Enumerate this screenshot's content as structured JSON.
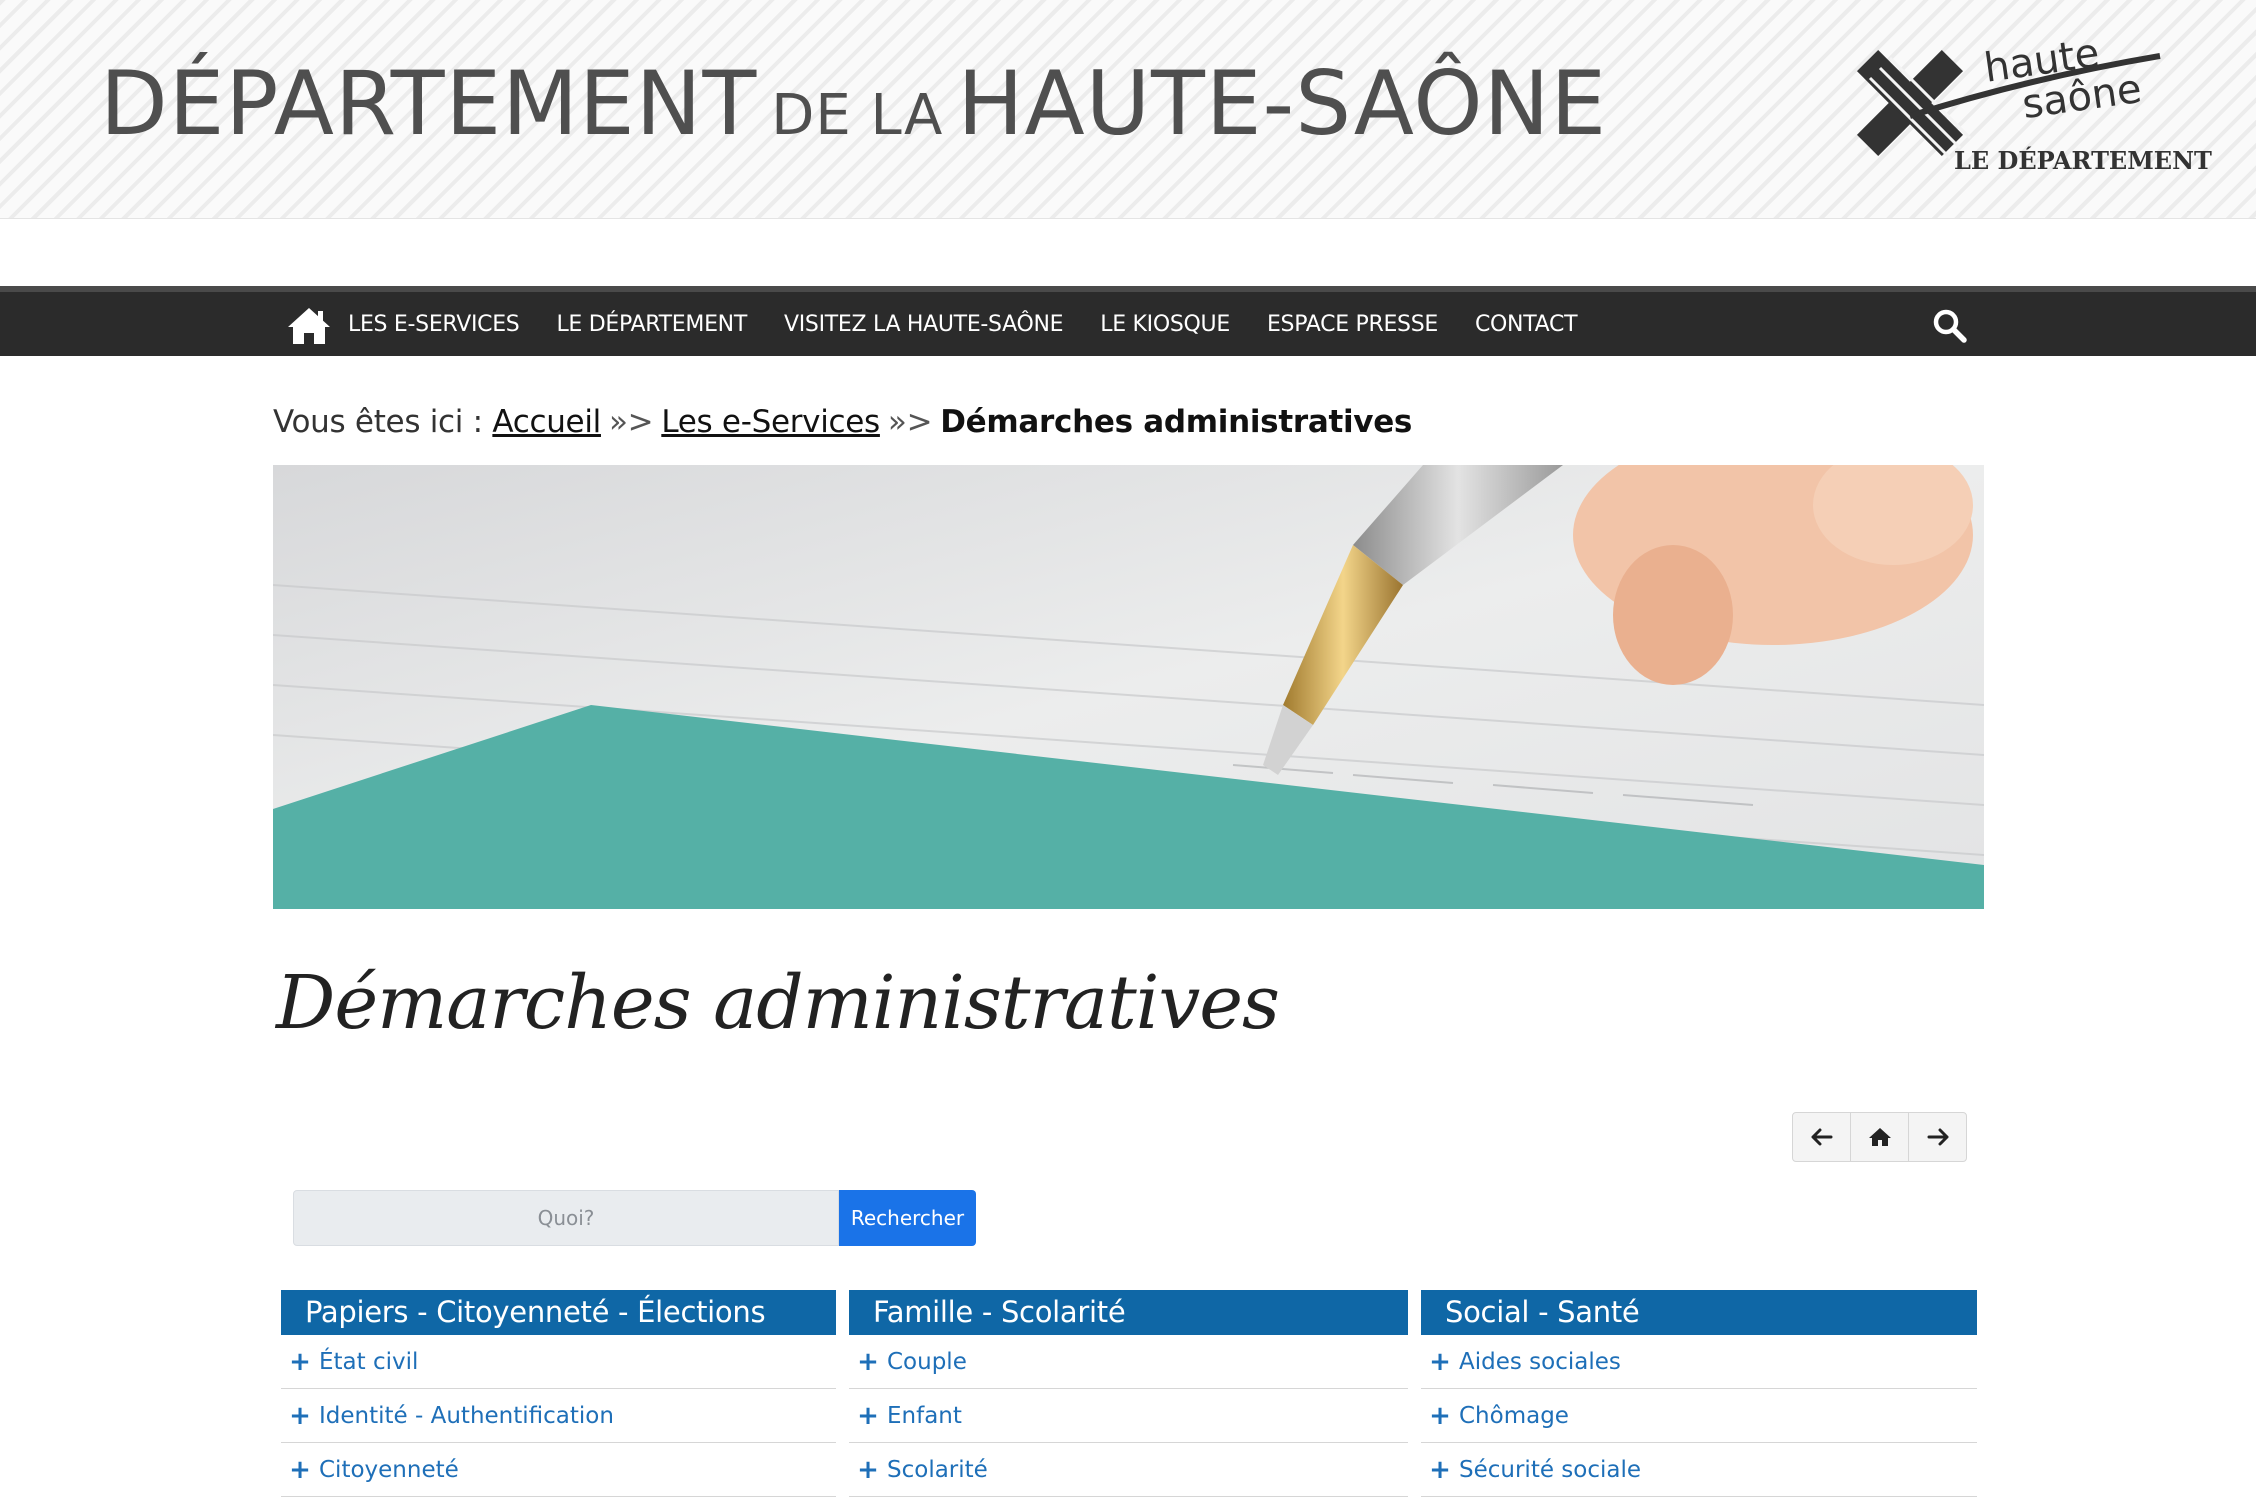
{
  "header": {
    "title_part1": "DÉPARTEMENT",
    "title_part2": "DE LA",
    "title_part3": "HAUTE-SAÔNE",
    "logo_word1": "haute",
    "logo_word2": "saône",
    "logo_sub": "LE DÉPARTEMENT"
  },
  "nav": {
    "home_icon": "home-icon",
    "items": [
      "LES E-SERVICES",
      "LE DÉPARTEMENT",
      "VISITEZ LA HAUTE-SAÔNE",
      "LE KIOSQUE",
      "ESPACE PRESSE",
      "CONTACT"
    ],
    "search_icon": "search-icon"
  },
  "breadcrumb": {
    "prefix": "Vous êtes ici :",
    "links": [
      "Accueil",
      "Les e-Services"
    ],
    "separator": "»>",
    "current": "Démarches administratives"
  },
  "page": {
    "title": "Démarches administratives"
  },
  "pager": {
    "icons": [
      "arrow-left-icon",
      "home-icon",
      "arrow-right-icon"
    ]
  },
  "search": {
    "placeholder": "Quoi?",
    "button_label": "Rechercher"
  },
  "categories": [
    {
      "title": "Papiers - Citoyenneté - Élections",
      "items": [
        "État civil",
        "Identité - Authentification",
        "Citoyenneté"
      ]
    },
    {
      "title": "Famille - Scolarité",
      "items": [
        "Couple",
        "Enfant",
        "Scolarité"
      ]
    },
    {
      "title": "Social - Santé",
      "items": [
        "Aides sociales",
        "Chômage",
        "Sécurité sociale"
      ]
    }
  ],
  "colors": {
    "nav_bg": "#2b2b2b",
    "category_header": "#0f67a6",
    "link": "#1e6fb8",
    "search_button": "#1a73e8",
    "banner_accent": "#55b0a6"
  }
}
